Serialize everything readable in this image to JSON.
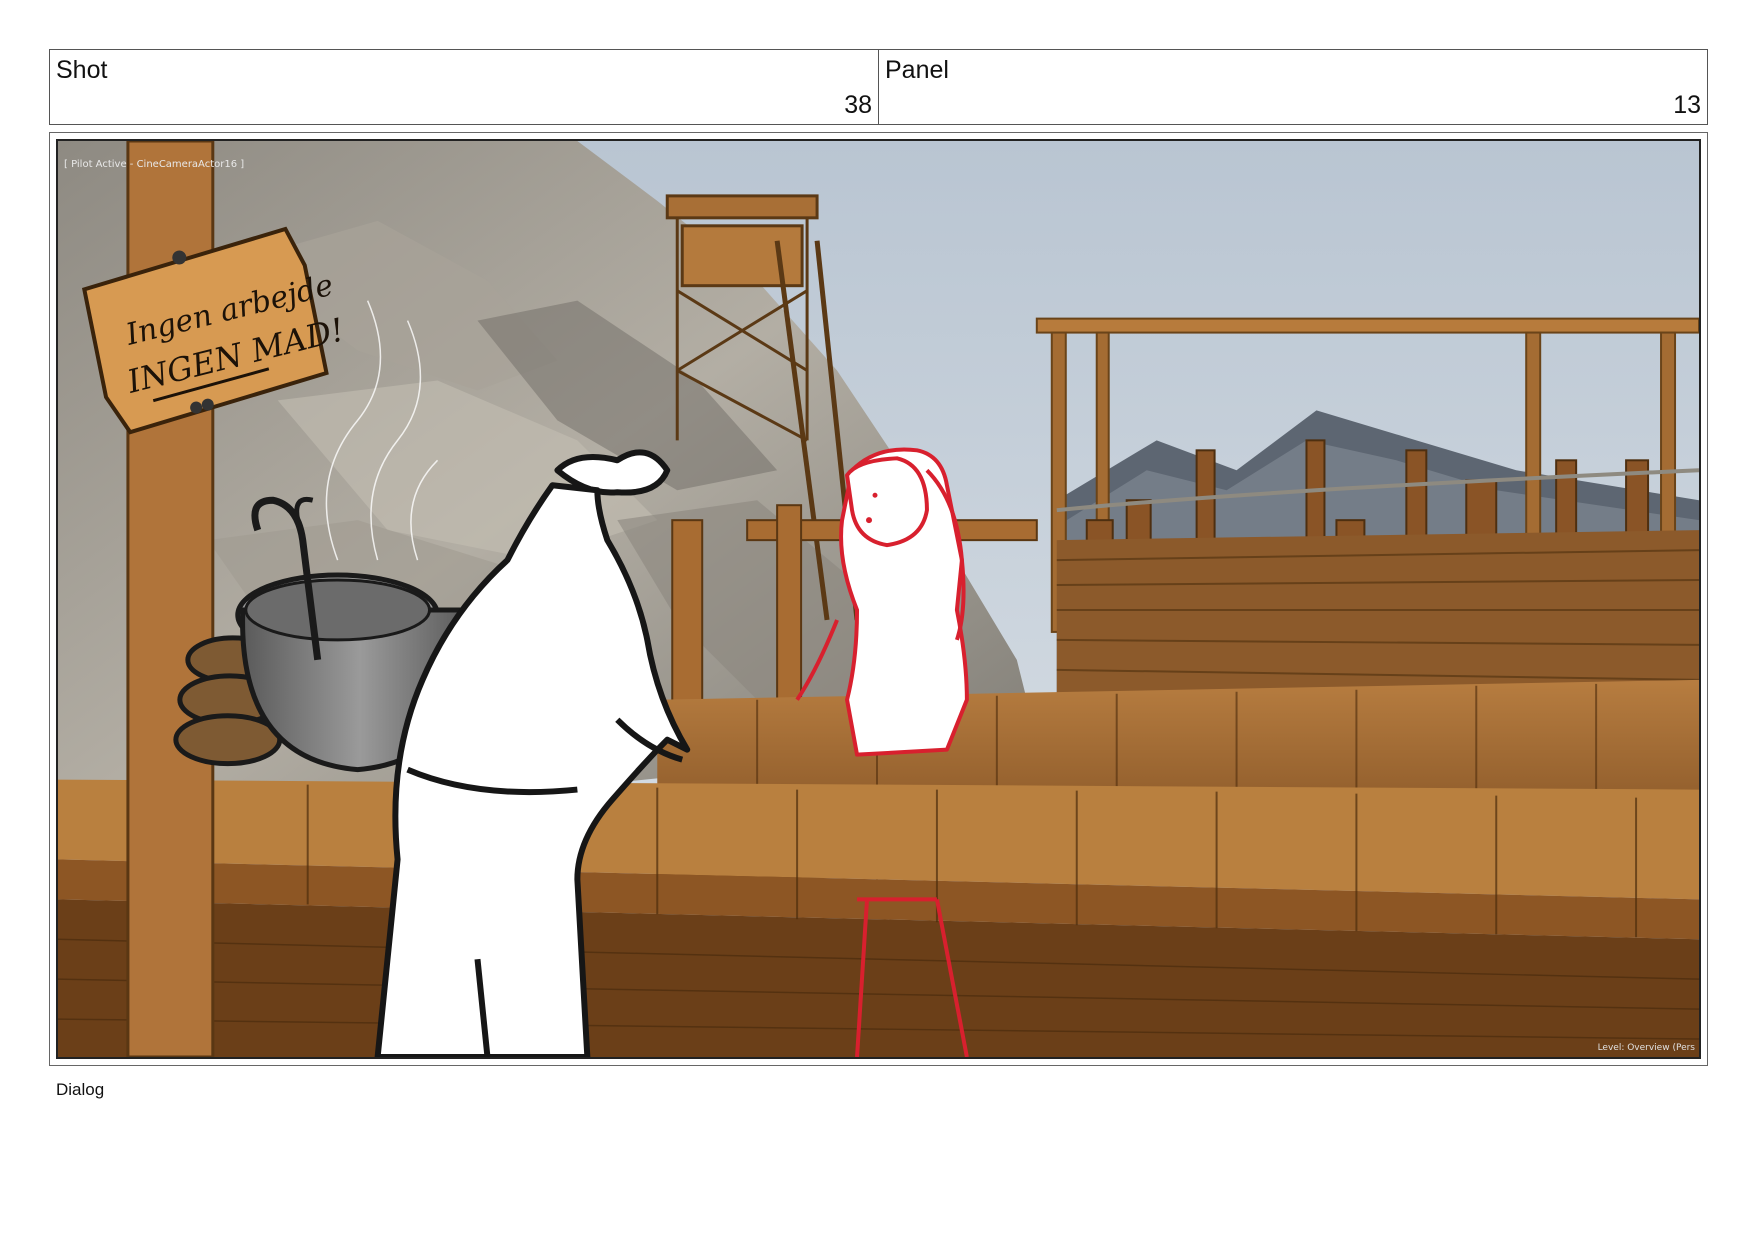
{
  "header": {
    "shot_label": "Shot",
    "shot_number": "38",
    "panel_label": "Panel",
    "panel_number": "13"
  },
  "viewport": {
    "camera_overlay": "[ Pilot Active - CineCameraActor16 ]",
    "level_overlay": "Level: Overview (Pers",
    "sign_line_1": "Ingen arbejde",
    "sign_line_2": "INGEN MAD!"
  },
  "footer": {
    "dialog_label": "Dialog"
  },
  "colors": {
    "sky": "#c9d3dc",
    "rock": "#9b968c",
    "wood": "#a06a34",
    "wood_dark": "#6b421c",
    "sketch_red": "#d8202e",
    "sketch_black": "#1a1a1a"
  }
}
